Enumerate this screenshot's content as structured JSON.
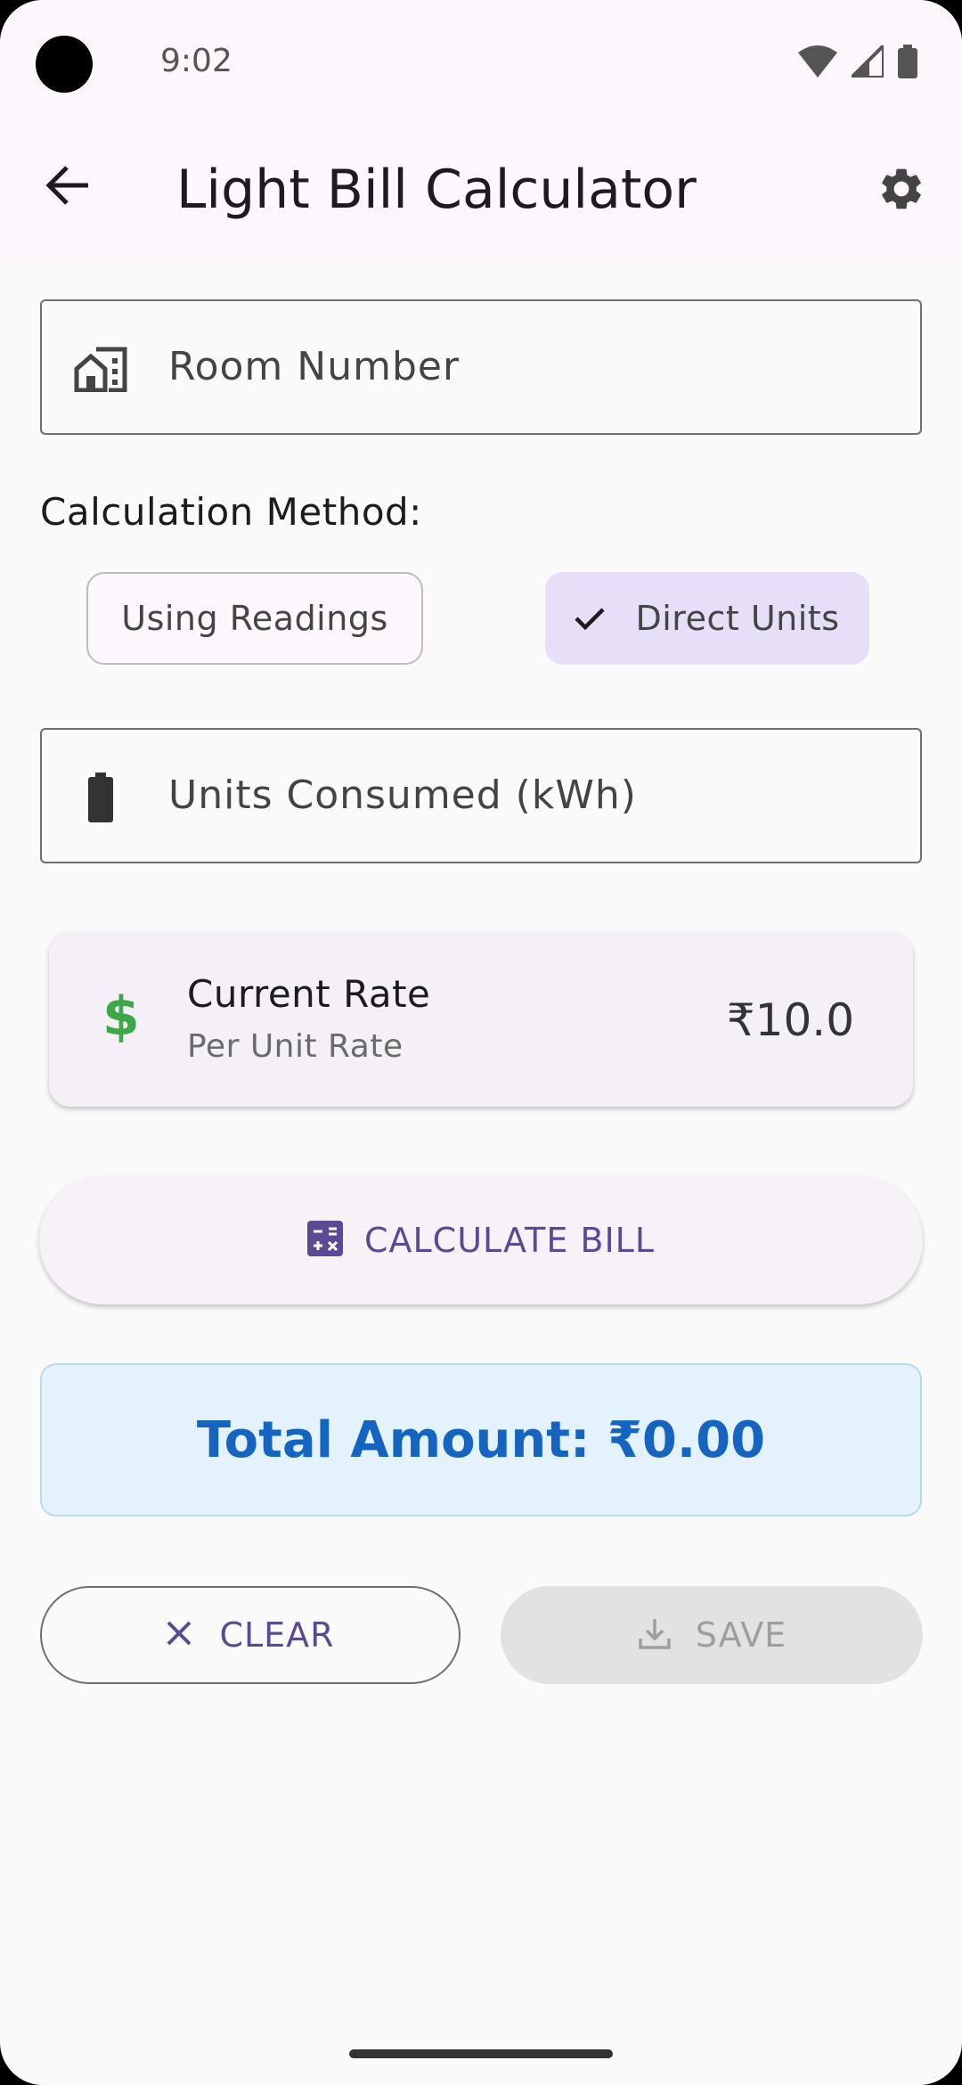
{
  "status_bar": {
    "time": "9:02"
  },
  "app_bar": {
    "title": "Light Bill Calculator"
  },
  "room_field": {
    "placeholder": "Room Number"
  },
  "method": {
    "label": "Calculation Method:",
    "options": [
      {
        "label": "Using Readings",
        "selected": false
      },
      {
        "label": "Direct Units",
        "selected": true
      }
    ]
  },
  "units_field": {
    "placeholder": "Units Consumed (kWh)"
  },
  "rate_card": {
    "title": "Current Rate",
    "subtitle": "Per Unit Rate",
    "value": "₹10.0",
    "icon": "$"
  },
  "calculate_button": {
    "label": "CALCULATE BILL"
  },
  "total": {
    "text": "Total Amount: ₹0.00"
  },
  "clear_button": {
    "label": "CLEAR"
  },
  "save_button": {
    "label": "SAVE",
    "enabled": false
  },
  "colors": {
    "accent": "#5b4a93",
    "total_text": "#1565c0",
    "rate_icon": "#3da84a"
  }
}
